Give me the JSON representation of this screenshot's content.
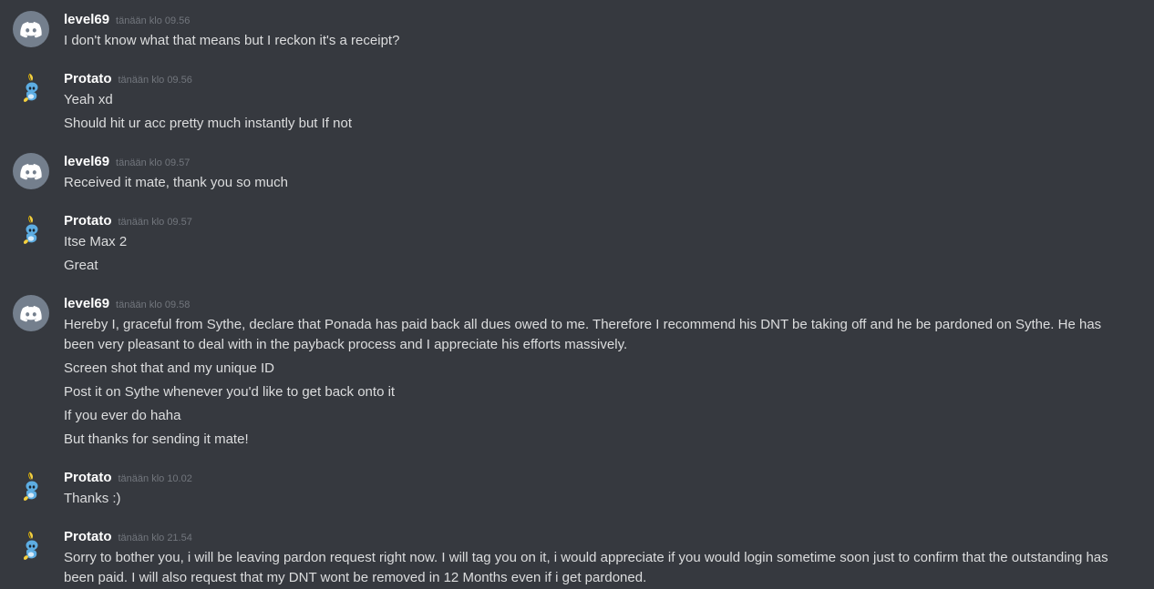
{
  "colors": {
    "background": "#36393f",
    "username": "#ffffff",
    "timestamp": "#72767d",
    "message_text": "#dcddde",
    "discord_avatar_bg": "#747f8d"
  },
  "messages": [
    {
      "author": "level69",
      "avatar": "discord-default-avatar-icon",
      "timestamp": "tänään klo 09.56",
      "lines": [
        "I don't know what that means but I reckon it's a receipt?"
      ]
    },
    {
      "author": "Protato",
      "avatar": "sobble-avatar-icon",
      "timestamp": "tänään klo 09.56",
      "lines": [
        "Yeah xd",
        "Should hit ur acc pretty much instantly but If not"
      ]
    },
    {
      "author": "level69",
      "avatar": "discord-default-avatar-icon",
      "timestamp": "tänään klo 09.57",
      "lines": [
        "Received it mate, thank you so much"
      ]
    },
    {
      "author": "Protato",
      "avatar": "sobble-avatar-icon",
      "timestamp": "tänään klo 09.57",
      "lines": [
        "Itse Max 2",
        "Great"
      ]
    },
    {
      "author": "level69",
      "avatar": "discord-default-avatar-icon",
      "timestamp": "tänään klo 09.58",
      "lines": [
        "Hereby I, graceful from Sythe, declare that Ponada has paid back all dues owed to me. Therefore I recommend his DNT be taking off and he be pardoned on Sythe. He has been very pleasant to deal with in the payback process and I appreciate his efforts massively.",
        "Screen shot that and my unique ID",
        "Post it on Sythe whenever you'd like to get back onto it",
        "If you ever do haha",
        "But thanks for sending it mate!"
      ]
    },
    {
      "author": "Protato",
      "avatar": "sobble-avatar-icon",
      "timestamp": "tänään klo 10.02",
      "lines": [
        "Thanks :)"
      ]
    },
    {
      "author": "Protato",
      "avatar": "sobble-avatar-icon",
      "timestamp": "tänään klo 21.54",
      "lines": [
        "Sorry to bother you, i will be leaving pardon request right now. I will tag you on it, i would appreciate if you would login sometime soon just to confirm that the outstanding has been paid. I will also request that my DNT wont be removed in 12 Months even if i get pardoned."
      ]
    }
  ]
}
